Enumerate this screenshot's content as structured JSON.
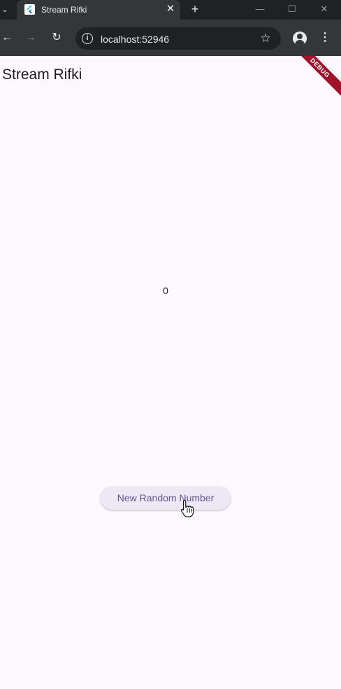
{
  "browser": {
    "tab_title": "Stream Rifki",
    "url": "localhost:52946"
  },
  "app": {
    "title": "Stream Rifki",
    "number": "0",
    "button_label": "New Random Number",
    "debug_label": "DEBUG"
  },
  "colors": {
    "background": "#fdf7fe",
    "button_bg": "#eee7f4",
    "button_text": "#65558f",
    "debug_banner": "#a1132b"
  }
}
